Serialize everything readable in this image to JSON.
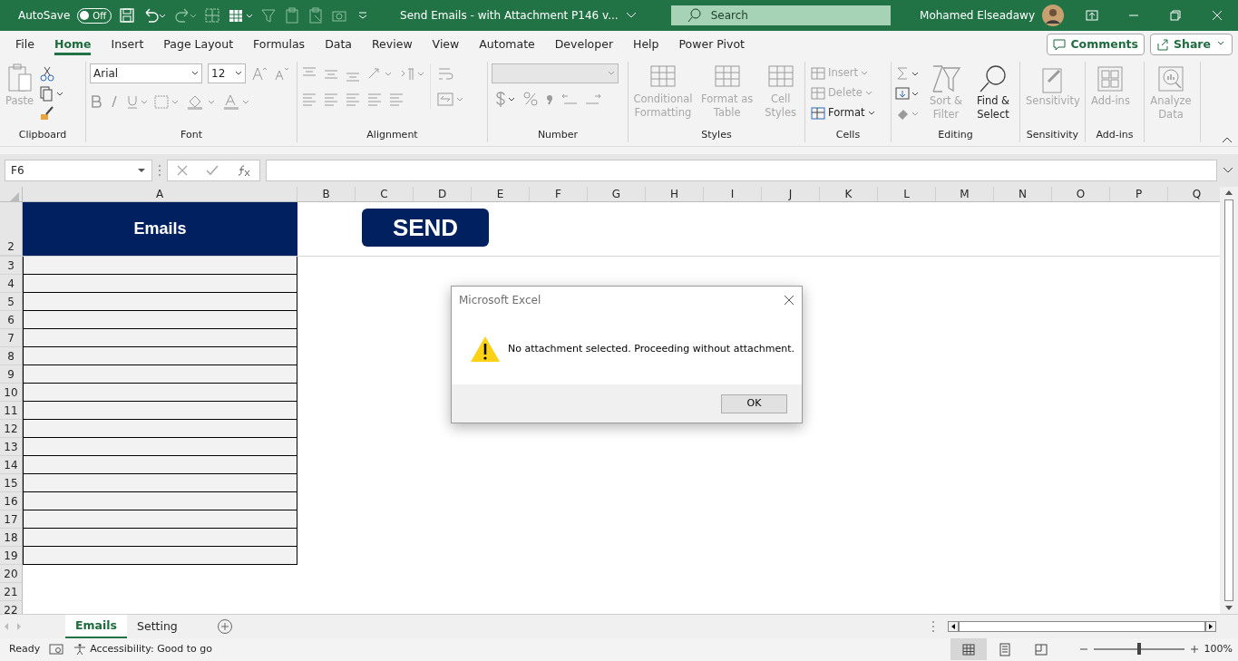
{
  "title_bar": {
    "autosave": {
      "label": "AutoSave",
      "on": false,
      "state_text": "Off"
    },
    "title": "Send Emails - with Attachment P146 v...",
    "search": {
      "placeholder": "Search"
    },
    "user": "Mohamed Elseadawy"
  },
  "menu_tabs": [
    {
      "label": "File",
      "selected": false
    },
    {
      "label": "Home",
      "selected": true
    },
    {
      "label": "Insert",
      "selected": false
    },
    {
      "label": "Page Layout",
      "selected": false
    },
    {
      "label": "Formulas",
      "selected": false
    },
    {
      "label": "Data",
      "selected": false
    },
    {
      "label": "Review",
      "selected": false
    },
    {
      "label": "View",
      "selected": false
    },
    {
      "label": "Automate",
      "selected": false
    },
    {
      "label": "Developer",
      "selected": false
    },
    {
      "label": "Help",
      "selected": false
    },
    {
      "label": "Power Pivot",
      "selected": false
    }
  ],
  "header_buttons": {
    "comments": "Comments",
    "share": "Share"
  },
  "ribbon": [
    {
      "kind": "clipboard",
      "label": "Clipboard",
      "items": [
        {
          "label": "Paste",
          "disabled": true
        }
      ]
    },
    {
      "kind": "font",
      "label": "Font",
      "items": [
        {
          "label": "Arial"
        },
        {
          "label": "12"
        }
      ]
    },
    {
      "kind": "alignment",
      "label": "Alignment"
    },
    {
      "kind": "number",
      "label": "Number"
    },
    {
      "kind": "styles",
      "label": "Styles",
      "items": [
        {
          "label": "Conditional Formatting",
          "disabled": true
        },
        {
          "label": "Format as Table",
          "disabled": true
        },
        {
          "label": "Cell Styles",
          "disabled": true
        }
      ]
    },
    {
      "kind": "cells",
      "label": "Cells",
      "items": [
        {
          "label": "Insert",
          "disabled": true
        },
        {
          "label": "Delete",
          "disabled": true
        },
        {
          "label": "Format",
          "disabled": false
        }
      ]
    },
    {
      "kind": "editing",
      "label": "Editing",
      "items": [
        {
          "label": "Sort & Filter",
          "disabled": true
        },
        {
          "label": "Find & Select",
          "disabled": false
        }
      ]
    },
    {
      "kind": "sensitivity",
      "label": "Sensitivity",
      "items": [
        {
          "label": "Sensitivity",
          "disabled": true
        }
      ]
    },
    {
      "kind": "addins",
      "label": "Add-ins",
      "items": [
        {
          "label": "Add-ins",
          "disabled": true
        }
      ]
    },
    {
      "kind": "analyze",
      "items": [
        {
          "label": "Analyze Data",
          "disabled": true
        }
      ]
    }
  ],
  "formula_bar": {
    "name_box": "F6"
  },
  "columns": [
    "A",
    "B",
    "C",
    "D",
    "E",
    "F",
    "G",
    "H",
    "I",
    "J",
    "K",
    "L",
    "M",
    "N",
    "O",
    "P",
    "Q"
  ],
  "rows": [
    {
      "number": "2",
      "kind": "header",
      "text": "Emails"
    },
    {
      "number": "3",
      "kind": "table"
    },
    {
      "number": "4",
      "kind": "table"
    },
    {
      "number": "5",
      "kind": "table"
    },
    {
      "number": "6",
      "kind": "table"
    },
    {
      "number": "7",
      "kind": "table"
    },
    {
      "number": "8",
      "kind": "table"
    },
    {
      "number": "9",
      "kind": "table"
    },
    {
      "number": "10",
      "kind": "table"
    },
    {
      "number": "11",
      "kind": "table"
    },
    {
      "number": "12",
      "kind": "table"
    },
    {
      "number": "13",
      "kind": "table"
    },
    {
      "number": "14",
      "kind": "table"
    },
    {
      "number": "15",
      "kind": "table"
    },
    {
      "number": "16",
      "kind": "table"
    },
    {
      "number": "17",
      "kind": "table"
    },
    {
      "number": "18",
      "kind": "table"
    },
    {
      "number": "19",
      "kind": "table"
    },
    {
      "number": "20",
      "kind": "plain"
    },
    {
      "number": "21",
      "kind": "plain"
    },
    {
      "number": "22",
      "kind": "plain"
    }
  ],
  "send_button": "SEND",
  "dialog": {
    "title": "Microsoft Excel",
    "message": "No attachment selected. Proceeding without attachment.",
    "ok": "OK"
  },
  "sheet_tabs": [
    {
      "label": "Emails",
      "selected": true
    },
    {
      "label": "Setting",
      "selected": false
    }
  ],
  "status_bar": {
    "mode": "Ready",
    "accessibility": "Accessibility: Good to go",
    "zoom": {
      "level": 0.5,
      "reading": "100%"
    }
  }
}
